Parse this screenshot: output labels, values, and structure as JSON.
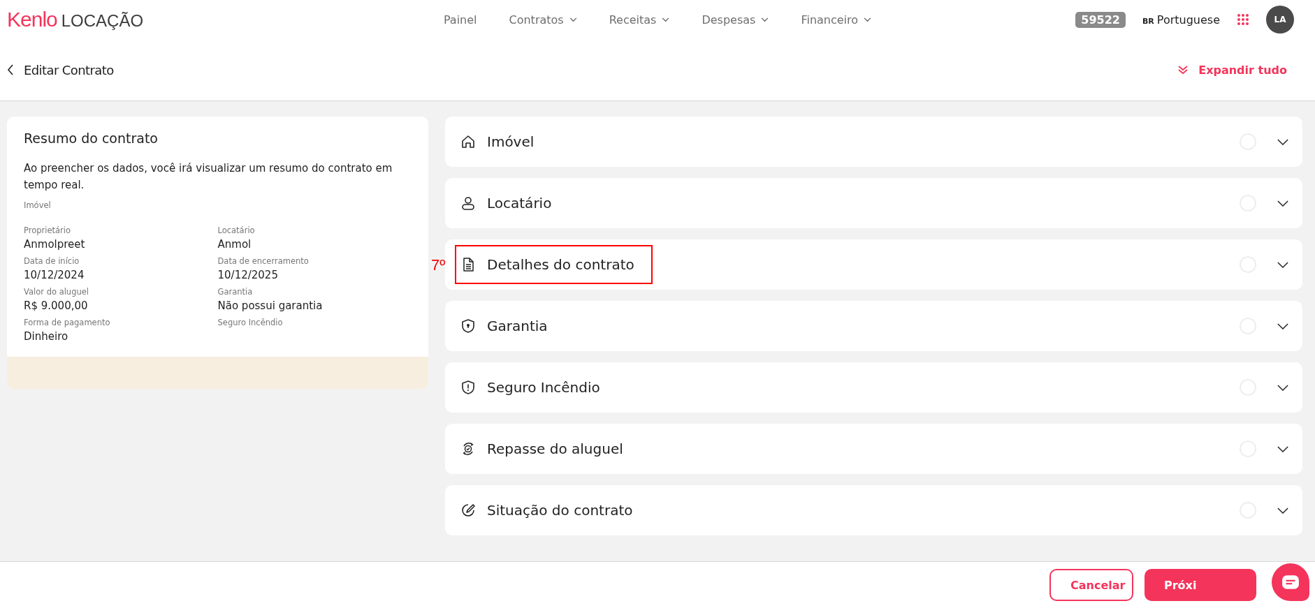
{
  "header": {
    "logo_brand": "Kenlo",
    "logo_product": "LOCAÇÃO",
    "nav": [
      {
        "label": "Painel",
        "dropdown": false
      },
      {
        "label": "Contratos",
        "dropdown": true
      },
      {
        "label": "Receitas",
        "dropdown": true
      },
      {
        "label": "Despesas",
        "dropdown": true
      },
      {
        "label": "Financeiro",
        "dropdown": true
      }
    ],
    "badge": "59522",
    "language_code": "BR",
    "language": "Portuguese",
    "avatar": "LA"
  },
  "page": {
    "title": "Editar Contrato",
    "expand_all": "Expandir tudo"
  },
  "summary": {
    "title": "Resumo do contrato",
    "description": "Ao preencher os dados, você irá visualizar um resumo do contrato em tempo real.",
    "property_label": "Imóvel",
    "fields": [
      {
        "label": "Proprietário",
        "value": "Anmolpreet"
      },
      {
        "label": "Locatário",
        "value": "Anmol"
      },
      {
        "label": "Data de início",
        "value": "10/12/2024"
      },
      {
        "label": "Data de encerramento",
        "value": "10/12/2025"
      },
      {
        "label": "Valor do aluguel",
        "value": "R$ 9.000,00"
      },
      {
        "label": "Garantia",
        "value": "Não possui garantia"
      },
      {
        "label": "Forma de pagamento",
        "value": "Dinheiro"
      },
      {
        "label": "Seguro Incêndio"
      }
    ]
  },
  "sections": [
    {
      "kind": "house",
      "title": "Imóvel",
      "expanded": false,
      "complete": false
    },
    {
      "kind": "person",
      "title": "Locatário",
      "expanded": false,
      "complete": false
    },
    {
      "kind": "document",
      "title": "Detalhes do contrato",
      "expanded": false,
      "complete": false,
      "highlighted": true,
      "annotation": "7º"
    },
    {
      "kind": "shield-lock",
      "title": "Garantia",
      "expanded": false,
      "complete": false
    },
    {
      "kind": "shield-alert",
      "title": "Seguro Incêndio",
      "expanded": false,
      "complete": false
    },
    {
      "kind": "cycle",
      "title": "Repasse do aluguel",
      "expanded": false,
      "complete": false
    },
    {
      "kind": "pen",
      "title": "Situação do contrato",
      "expanded": false,
      "complete": false
    }
  ],
  "footer": {
    "buttons": [
      {
        "label": "Cancelar",
        "kind": "secondary"
      },
      {
        "label": "Próxi",
        "kind": "primary"
      }
    ]
  }
}
